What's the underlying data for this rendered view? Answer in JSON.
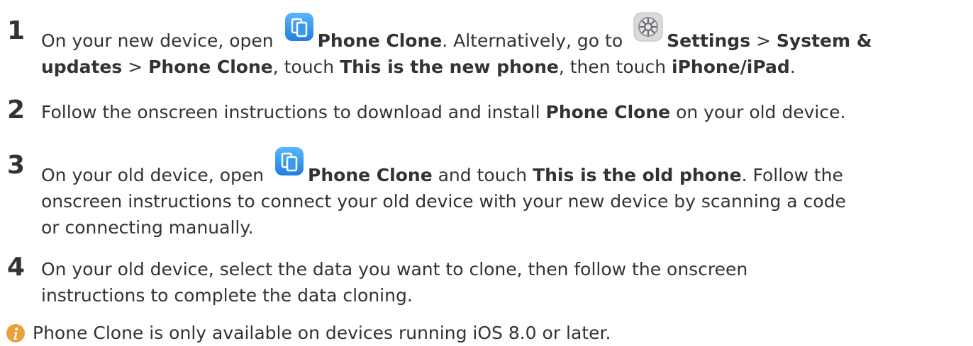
{
  "steps": [
    {
      "number": "1",
      "line1": {
        "t1": "On your new device, open ",
        "b1": "Phone Clone",
        "t2": ". Alternatively, go to ",
        "b2": "Settings",
        "t3": " > ",
        "b3": "System &"
      },
      "line2": {
        "b1": "updates",
        "t1": " > ",
        "b2": "Phone Clone",
        "t2": ", touch ",
        "b3": "This is the new phone",
        "t3": ", then touch ",
        "b4": "iPhone/iPad",
        "t4": "."
      }
    },
    {
      "number": "2",
      "line1": {
        "t1": "Follow the onscreen instructions to download and install ",
        "b1": "Phone Clone",
        "t2": " on your old device."
      }
    },
    {
      "number": "3",
      "line1": {
        "t1": "On your old device, open ",
        "b1": "Phone Clone",
        "t2": " and touch ",
        "b2": "This is the old phone",
        "t3": ". Follow the"
      },
      "line2": "onscreen instructions to connect your old device with your new device by scanning a code",
      "line3": "or connecting manually."
    },
    {
      "number": "4",
      "line1": "On your old device, select the data you want to clone, then follow the onscreen",
      "line2": "instructions to complete the data cloning."
    }
  ],
  "note": "Phone Clone is only available on devices running iOS 8.0 or later.",
  "icons": {
    "phone_clone": "phone-clone-app-icon",
    "settings": "settings-gear-icon",
    "info": "info-icon"
  },
  "colors": {
    "text": "#333333",
    "phone_clone_icon": "#2f8fe8",
    "info_icon": "#e6a23c"
  }
}
